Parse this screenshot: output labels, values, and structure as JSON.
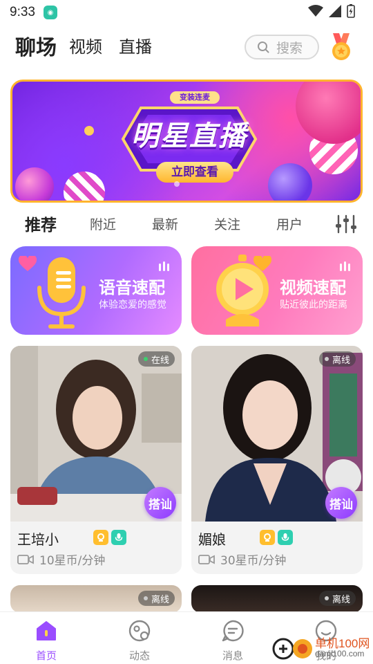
{
  "status_bar": {
    "time": "9:33"
  },
  "top_nav": {
    "tabs": [
      {
        "label": "聊场",
        "active": true
      },
      {
        "label": "视频",
        "active": false
      },
      {
        "label": "直播",
        "active": false
      }
    ],
    "search_placeholder": "搜索",
    "medal_icon": "medal-icon"
  },
  "banner": {
    "tag": "变装连麦",
    "title": "明星直播",
    "cta": "立即查看",
    "border_color": "#ffb42d"
  },
  "categories": {
    "tabs": [
      {
        "label": "推荐",
        "active": true
      },
      {
        "label": "附近",
        "active": false
      },
      {
        "label": "最新",
        "active": false
      },
      {
        "label": "关注",
        "active": false
      },
      {
        "label": "用户",
        "active": false
      }
    ],
    "filter_icon": "sliders-icon"
  },
  "match_cards": [
    {
      "title": "语音速配",
      "subtitle": "体验恋爱的感觉",
      "icon": "microphone-icon"
    },
    {
      "title": "视频速配",
      "subtitle": "贴近彼此的距离",
      "icon": "play-icon"
    }
  ],
  "users": [
    {
      "name": "王培小",
      "status": "在线",
      "status_color": "#3ecf6f",
      "action": "搭讪",
      "price": "10星币/分钟"
    },
    {
      "name": "媚娘",
      "status": "离线",
      "status_color": "#cccccc",
      "action": "搭讪",
      "price": "30星币/分钟"
    },
    {
      "status": "离线",
      "status_color": "#cccccc"
    },
    {
      "status": "离线",
      "status_color": "#cccccc"
    }
  ],
  "bottom_nav": [
    {
      "label": "首页",
      "icon": "home-icon",
      "active": true
    },
    {
      "label": "动态",
      "icon": "moments-icon",
      "active": false
    },
    {
      "label": "消息",
      "icon": "message-icon",
      "active": false
    },
    {
      "label": "我的",
      "icon": "profile-icon",
      "active": false
    }
  ],
  "watermark": {
    "text": "单机100网",
    "url": "danji100.com"
  },
  "colors": {
    "accent": "#9a4dff",
    "online": "#3ecf6f",
    "offline": "#cccccc"
  }
}
